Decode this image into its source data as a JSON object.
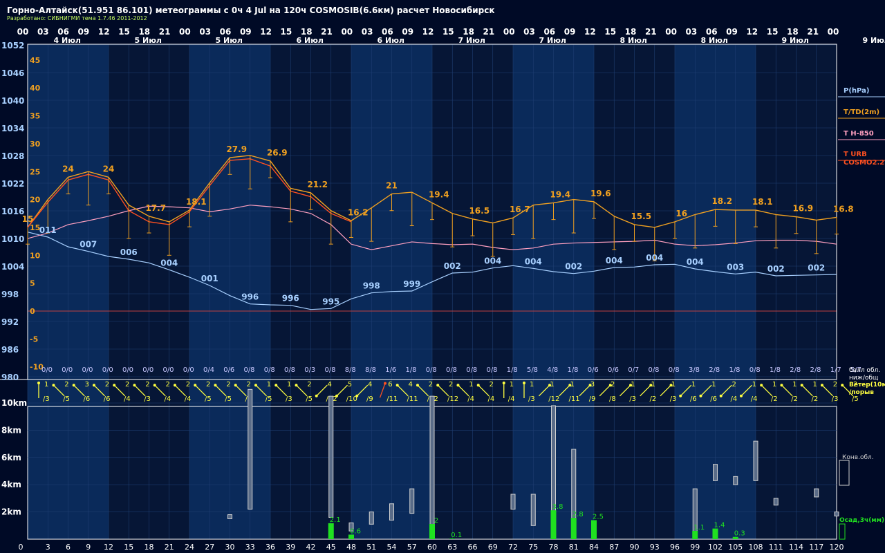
{
  "title": "Горно-Алтайск(51.951 86.101) метеограммы с  0ч 4 Jul на 120ч COSMOSIB(6.6км) расчет Новосибирск",
  "subtitle": "Разработано: СИБНИГМИ тема 1.7.46 2011-2012",
  "colors": {
    "background": "#0a1a3a",
    "pressure": "#a8d0ff",
    "temperature": "#f0a020",
    "t850": "#ffa0c0",
    "t_urb": "#ff5020",
    "wind": "#ffff40",
    "precip": "#20e020",
    "cloud": "#d0d0d0",
    "axis_text": "#ffffff"
  },
  "chart_data": [
    {
      "type": "line",
      "name": "meteogram-main",
      "hours_top": [
        "00",
        "03",
        "06",
        "09",
        "12",
        "15",
        "18",
        "21",
        "00",
        "03",
        "06",
        "09",
        "12",
        "15",
        "18",
        "21",
        "00",
        "03",
        "06",
        "09",
        "12",
        "15",
        "18",
        "21",
        "00",
        "03",
        "06",
        "09",
        "12",
        "15",
        "18",
        "21",
        "00",
        "03",
        "06",
        "09",
        "12",
        "15",
        "18",
        "21",
        "00"
      ],
      "day_labels": [
        {
          "hour": 1,
          "label": "4 Июл"
        },
        {
          "hour": 5,
          "label": "5 Июл"
        },
        {
          "hour": 9,
          "label": "5 Июл"
        },
        {
          "hour": 13,
          "label": "6 Июл"
        },
        {
          "hour": 17,
          "label": "6 Июл"
        },
        {
          "hour": 21,
          "label": "7 Июл"
        },
        {
          "hour": 25,
          "label": "7 Июл"
        },
        {
          "hour": 29,
          "label": "8 Июл"
        },
        {
          "hour": 33,
          "label": "8 Июл"
        },
        {
          "hour": 37,
          "label": "9 Июл"
        },
        {
          "hour": 41,
          "label": "9 Июл"
        }
      ],
      "pressure_axis": {
        "ticks": [
          1052,
          1046,
          1040,
          1034,
          1028,
          1022,
          1016,
          1010,
          1004,
          998,
          992,
          986,
          980
        ],
        "range": [
          980,
          1052
        ]
      },
      "temperature_axis": {
        "ticks": [
          45,
          40,
          35,
          30,
          25,
          20,
          15,
          10,
          5,
          0,
          -5,
          -10
        ],
        "range": [
          -13,
          50
        ]
      },
      "legend": [
        {
          "label": "P(hPa)",
          "color": "#a8d0ff"
        },
        {
          "label": "T/TD(2m)",
          "color": "#f0a020"
        },
        {
          "label": "T H-850",
          "color": "#ffa0c0"
        },
        {
          "label": "T URB",
          "color": "#ff5020"
        },
        {
          "label": "COSMO2.2",
          "color": "#ff5020"
        }
      ],
      "series": [
        {
          "name": "P(hPa)",
          "x": [
            0,
            3,
            6,
            9,
            12,
            15,
            18,
            21,
            24,
            27,
            30,
            33,
            36,
            39,
            42,
            45,
            48,
            51,
            54,
            57,
            60,
            63,
            66,
            69,
            72,
            75,
            78,
            81,
            84,
            87,
            90,
            93,
            96,
            99,
            102,
            105,
            108,
            111,
            114,
            117,
            120
          ],
          "values": [
            1011.4,
            1010.3,
            1008.2,
            1007.2,
            1006.1,
            1005.5,
            1004.7,
            1003.2,
            1001.6,
            999.8,
            997.6,
            995.8,
            995.6,
            995.5,
            994.6,
            994.8,
            996.9,
            998.2,
            998.5,
            998.6,
            1000.6,
            1002.5,
            1002.7,
            1003.6,
            1004.1,
            1003.5,
            1002.8,
            1002.4,
            1002.9,
            1003.7,
            1003.8,
            1004.3,
            1004.4,
            1003.4,
            1002.8,
            1002.3,
            1002.7,
            1001.9,
            1002.0,
            1002.1,
            1002.2
          ]
        },
        {
          "name": "T/TD(2m)",
          "x": [
            0,
            3,
            6,
            9,
            12,
            15,
            18,
            21,
            24,
            27,
            30,
            33,
            36,
            39,
            42,
            45,
            48,
            51,
            54,
            57,
            60,
            63,
            66,
            69,
            72,
            75,
            78,
            81,
            84,
            87,
            90,
            93,
            96,
            99,
            102,
            105,
            108,
            111,
            114,
            117,
            120
          ],
          "values": [
            15.0,
            20.0,
            24.0,
            25.0,
            24.0,
            19.0,
            17.0,
            16.0,
            18.1,
            23.0,
            27.5,
            27.9,
            26.9,
            22.0,
            21.2,
            18.0,
            16.2,
            18.5,
            21.0,
            21.3,
            19.4,
            17.5,
            16.5,
            15.8,
            16.7,
            19.0,
            19.4,
            20.0,
            19.6,
            17.0,
            15.5,
            15.0,
            16.0,
            17.3,
            18.2,
            18.1,
            18.1,
            17.3,
            16.9,
            16.3,
            16.8
          ]
        },
        {
          "name": "T H-850",
          "x": [
            0,
            3,
            6,
            9,
            12,
            15,
            18,
            21,
            24,
            27,
            30,
            33,
            36,
            39,
            42,
            45,
            48,
            51,
            54,
            57,
            60,
            63,
            66,
            69,
            72,
            75,
            78,
            81,
            84,
            87,
            90,
            93,
            96,
            99,
            102,
            105,
            108,
            111,
            114,
            117,
            120
          ],
          "values": [
            13.0,
            14.0,
            15.5,
            16.2,
            17.0,
            18.0,
            18.8,
            18.7,
            18.5,
            17.8,
            18.3,
            19.0,
            18.7,
            18.3,
            17.5,
            15.5,
            12.0,
            11.0,
            11.7,
            12.4,
            12.1,
            11.9,
            12.0,
            11.4,
            11.0,
            11.3,
            12.0,
            12.2,
            12.3,
            12.4,
            12.5,
            12.7,
            12.0,
            11.7,
            11.9,
            12.2,
            12.6,
            12.7,
            12.7,
            12.5,
            12.0
          ]
        },
        {
          "name": "T URB",
          "x": [
            0,
            3,
            6,
            9,
            12,
            15,
            18,
            21,
            24,
            27,
            30,
            33,
            36,
            39,
            42,
            45,
            48
          ],
          "values": [
            15.0,
            19.5,
            23.5,
            24.5,
            23.5,
            18.0,
            16.0,
            15.5,
            17.8,
            22.5,
            27.0,
            27.3,
            26.0,
            21.5,
            20.5,
            17.5,
            16.0
          ]
        }
      ],
      "temperature_labels": [
        {
          "x": 0,
          "label": "15"
        },
        {
          "x": 6,
          "label": "24"
        },
        {
          "x": 12,
          "label": "24"
        },
        {
          "x": 19,
          "label": "17.7"
        },
        {
          "x": 25,
          "label": "18.1"
        },
        {
          "x": 31,
          "label": "27.9"
        },
        {
          "x": 37,
          "label": "26.9"
        },
        {
          "x": 43,
          "label": "21.2"
        },
        {
          "x": 49,
          "label": "16.2"
        },
        {
          "x": 54,
          "label": "21"
        },
        {
          "x": 61,
          "label": "19.4"
        },
        {
          "x": 67,
          "label": "16.5"
        },
        {
          "x": 73,
          "label": "16.7"
        },
        {
          "x": 79,
          "label": "19.4"
        },
        {
          "x": 85,
          "label": "19.6"
        },
        {
          "x": 91,
          "label": "15.5"
        },
        {
          "x": 97,
          "label": "16"
        },
        {
          "x": 103,
          "label": "18.2"
        },
        {
          "x": 109,
          "label": "18.1"
        },
        {
          "x": 115,
          "label": "16.9"
        },
        {
          "x": 121,
          "label": "16.8"
        }
      ],
      "pressure_labels": [
        {
          "x": 3,
          "label": "011"
        },
        {
          "x": 9,
          "label": "007"
        },
        {
          "x": 15,
          "label": "006"
        },
        {
          "x": 21,
          "label": "004"
        },
        {
          "x": 27,
          "label": "001"
        },
        {
          "x": 33,
          "label": "996"
        },
        {
          "x": 39,
          "label": "996"
        },
        {
          "x": 45,
          "label": "995"
        },
        {
          "x": 51,
          "label": "998"
        },
        {
          "x": 57,
          "label": "999"
        },
        {
          "x": 63,
          "label": "002"
        },
        {
          "x": 69,
          "label": "004"
        },
        {
          "x": 75,
          "label": "004"
        },
        {
          "x": 81,
          "label": "002"
        },
        {
          "x": 87,
          "label": "004"
        },
        {
          "x": 93,
          "label": "004"
        },
        {
          "x": 99,
          "label": "004"
        },
        {
          "x": 105,
          "label": "003"
        },
        {
          "x": 111,
          "label": "002"
        },
        {
          "x": 117,
          "label": "002"
        }
      ],
      "cloud_cover": [
        "0/0",
        "0/0",
        "0/0",
        "0/0",
        "0/0",
        "0/0",
        "0/0",
        "0/0",
        "0/4",
        "0/6",
        "0/8",
        "0/8",
        "0/8",
        "0/3",
        "0/8",
        "8/8",
        "8/8",
        "1/6",
        "1/8",
        "0/8",
        "0/8",
        "0/8",
        "0/8",
        "1/8",
        "5/8",
        "4/8",
        "1/8",
        "0/6",
        "0/6",
        "0/7",
        "0/8",
        "0/8",
        "3/8",
        "2/8",
        "1/8",
        "0/8",
        "1/8",
        "2/8",
        "2/8",
        "1/7",
        "5/7"
      ],
      "cloud_cover_label": "балл обл. ниж/общ"
    },
    {
      "type": "bar",
      "name": "wind-and-convective-clouds",
      "wind_label": "Ветер(10м) /порыв",
      "wind_speed": [
        1,
        2,
        3,
        2,
        2,
        2,
        2,
        2,
        2,
        2,
        2,
        1,
        1,
        2,
        4,
        5,
        4,
        6,
        4,
        2,
        2,
        1,
        2,
        1,
        1,
        1,
        1,
        3,
        2,
        1,
        1,
        1,
        1,
        1,
        2,
        1,
        1,
        1,
        1,
        2,
        2
      ],
      "wind_gust": [
        3,
        5,
        6,
        6,
        4,
        3,
        4,
        4,
        5,
        5,
        5,
        5,
        3,
        5,
        12,
        10,
        9,
        11,
        11,
        12,
        12,
        4,
        4,
        4,
        3,
        12,
        11,
        9,
        8,
        3,
        2,
        3,
        6,
        6,
        4,
        4,
        2,
        2,
        2,
        3,
        5
      ],
      "wind_dir_deg": [
        270,
        225,
        225,
        225,
        225,
        225,
        225,
        225,
        225,
        225,
        225,
        225,
        225,
        225,
        135,
        135,
        135,
        290,
        225,
        225,
        225,
        225,
        225,
        270,
        270,
        315,
        315,
        315,
        315,
        315,
        315,
        315,
        135,
        135,
        135,
        135,
        225,
        225,
        225,
        225,
        225
      ],
      "height_axis": {
        "ticks": [
          "10km",
          "8km",
          "6km",
          "4km",
          "2km"
        ],
        "range": [
          0,
          11
        ]
      },
      "hours_bottom": [
        0,
        3,
        6,
        9,
        12,
        15,
        18,
        21,
        24,
        27,
        30,
        33,
        36,
        39,
        42,
        45,
        48,
        51,
        54,
        57,
        60,
        63,
        66,
        69,
        72,
        75,
        78,
        81,
        84,
        87,
        90,
        93,
        96,
        99,
        102,
        105,
        108,
        111,
        114,
        117,
        120
      ],
      "convective_label": "Конв.обл.",
      "precip_label": "Осад,3ч(мм)",
      "convective_clouds": [
        {
          "x": 30,
          "base": 1.5,
          "top": 1.8
        },
        {
          "x": 33,
          "base": 2.2,
          "top": 11.0
        },
        {
          "x": 45,
          "base": 1.6,
          "top": 10.5
        },
        {
          "x": 48,
          "base": 0.6,
          "top": 1.2
        },
        {
          "x": 51,
          "base": 1.1,
          "top": 2.0
        },
        {
          "x": 54,
          "base": 1.4,
          "top": 2.6
        },
        {
          "x": 57,
          "base": 1.9,
          "top": 3.7
        },
        {
          "x": 60,
          "base": 0.8,
          "top": 10.5
        },
        {
          "x": 72,
          "base": 2.2,
          "top": 3.3
        },
        {
          "x": 75,
          "base": 1.0,
          "top": 3.3
        },
        {
          "x": 78,
          "base": 1.0,
          "top": 9.8
        },
        {
          "x": 81,
          "base": 0.9,
          "top": 6.6
        },
        {
          "x": 84,
          "base": 0.9,
          "top": 1.1
        },
        {
          "x": 99,
          "base": 0.5,
          "top": 3.7
        },
        {
          "x": 102,
          "base": 4.3,
          "top": 5.5
        },
        {
          "x": 105,
          "base": 4.0,
          "top": 4.6
        },
        {
          "x": 108,
          "base": 4.3,
          "top": 7.2
        },
        {
          "x": 111,
          "base": 2.5,
          "top": 3.0
        },
        {
          "x": 117,
          "base": 3.1,
          "top": 3.7
        },
        {
          "x": 120,
          "base": 1.7,
          "top": 2.0
        }
      ],
      "precipitation": [
        {
          "x": 45,
          "value": 2.1,
          "label": "2.1"
        },
        {
          "x": 48,
          "value": 0.6,
          "label": "0.6"
        },
        {
          "x": 60,
          "value": 2.0,
          "label": "2"
        },
        {
          "x": 63,
          "value": 0.1,
          "label": "0.1"
        },
        {
          "x": 78,
          "value": 3.8,
          "label": "3.8"
        },
        {
          "x": 81,
          "value": 2.8,
          "label": "2.8"
        },
        {
          "x": 84,
          "value": 2.5,
          "label": "2.5"
        },
        {
          "x": 99,
          "value": 1.1,
          "label": "1.1"
        },
        {
          "x": 102,
          "value": 1.4,
          "label": "1.4"
        },
        {
          "x": 105,
          "value": 0.3,
          "label": "0.3"
        }
      ]
    }
  ]
}
